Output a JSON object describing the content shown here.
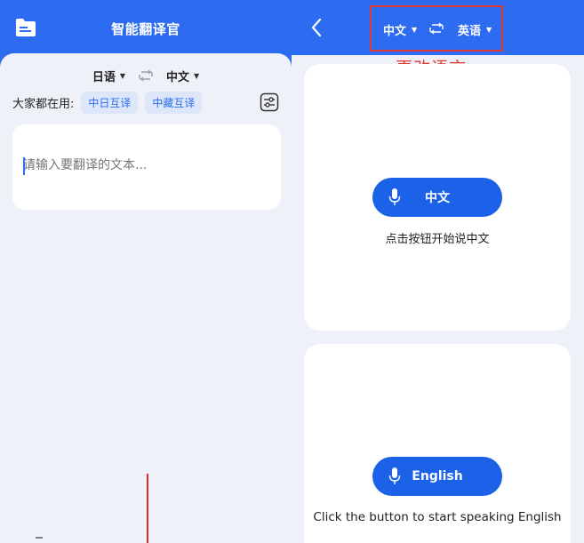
{
  "left": {
    "app_title": "智能翻译官",
    "source_lang": "日语",
    "target_lang": "中文",
    "common_label": "大家都在用:",
    "chips": [
      "中日互译",
      "中藏互译"
    ],
    "input_placeholder": "请输入要翻译的文本..."
  },
  "right": {
    "source_lang": "中文",
    "target_lang": "英语",
    "annotation": "更改语言",
    "cards": [
      {
        "button_label": "中文",
        "hint": "点击按钮开始说中文"
      },
      {
        "button_label": "English",
        "hint": "Click the button to start speaking English"
      }
    ]
  },
  "colors": {
    "primary": "#2d6cf0",
    "button": "#1c62e9",
    "annotation_red": "#e03a31",
    "panel_bg": "#eef1f7"
  },
  "icons": {
    "folder": "file-folder-icon",
    "swap": "swap-arrows-icon",
    "settings": "settings-sliders-icon",
    "back": "chevron-left-icon",
    "mic": "microphone-icon"
  }
}
